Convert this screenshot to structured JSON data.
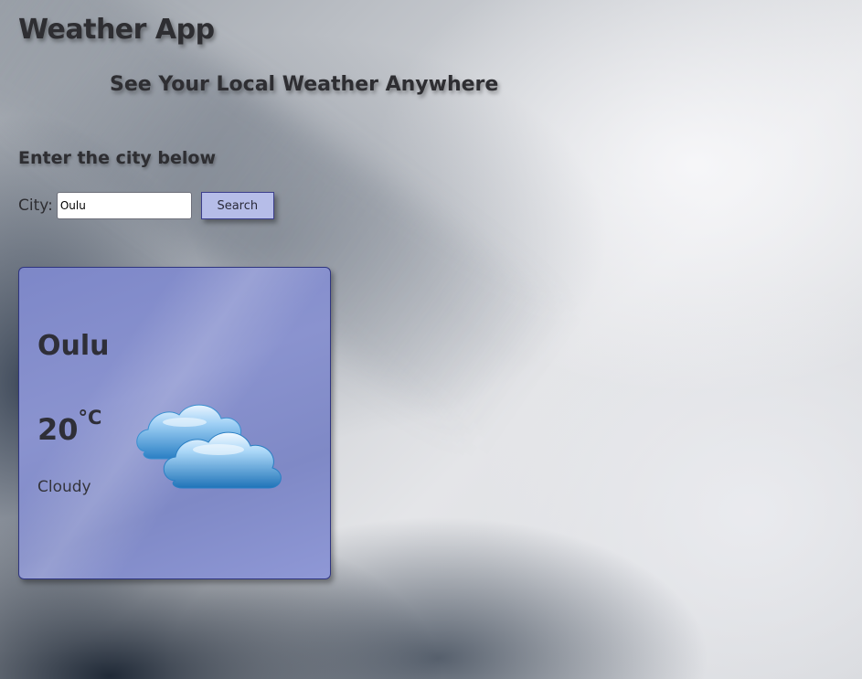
{
  "app": {
    "title": "Weather App",
    "subtitle": "See Your Local Weather Anywhere"
  },
  "search": {
    "prompt": "Enter the city below",
    "label": "City:",
    "value": "Oulu",
    "button_label": "Search"
  },
  "weather": {
    "city": "Oulu",
    "temperature": "20",
    "unit": "°C",
    "condition": "Cloudy",
    "icon": "cloud-icon"
  },
  "colors": {
    "card_bg": "#8a93cf",
    "card_border": "#2f3580",
    "button_bg": "#b6bde8",
    "cloud_blue": "#3a8fd0"
  }
}
